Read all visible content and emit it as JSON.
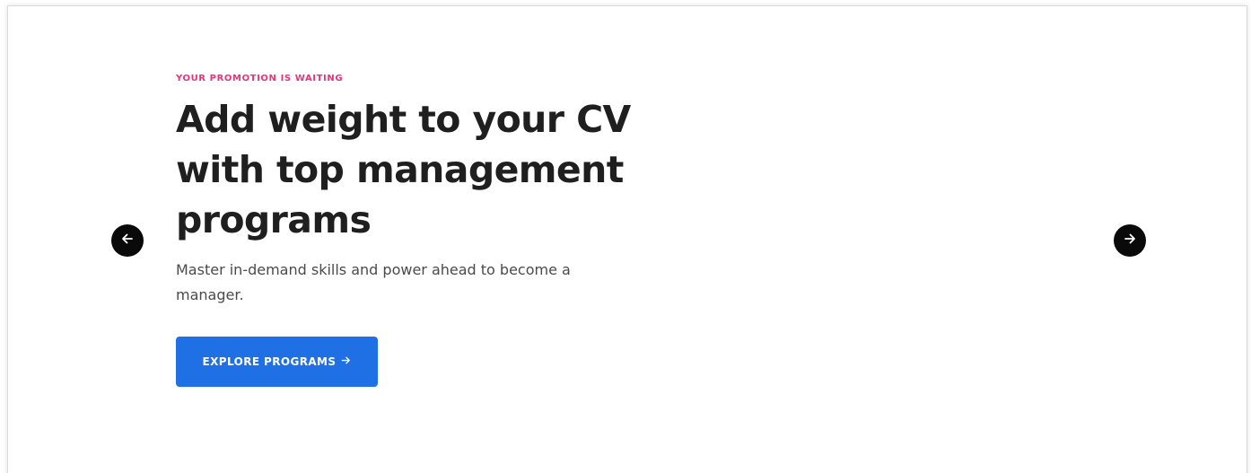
{
  "hero": {
    "eyebrow": "YOUR PROMOTION IS WAITING",
    "headline_line1": "Add weight to your CV",
    "headline_line2": "with top management",
    "headline_line3": "programs",
    "subtitle": "Master in-demand skills and power ahead to become a manager.",
    "cta_label": "EXPLORE PROGRAMS",
    "cta_icon": "arrow-right-icon"
  },
  "carousel": {
    "prev_icon": "arrow-left-icon",
    "next_icon": "arrow-right-icon"
  },
  "colors": {
    "eyebrow": "#e6357d",
    "cta_background": "#1f6fe5",
    "arrow_background": "#0a0a0a",
    "headline": "#1f1f1f"
  }
}
